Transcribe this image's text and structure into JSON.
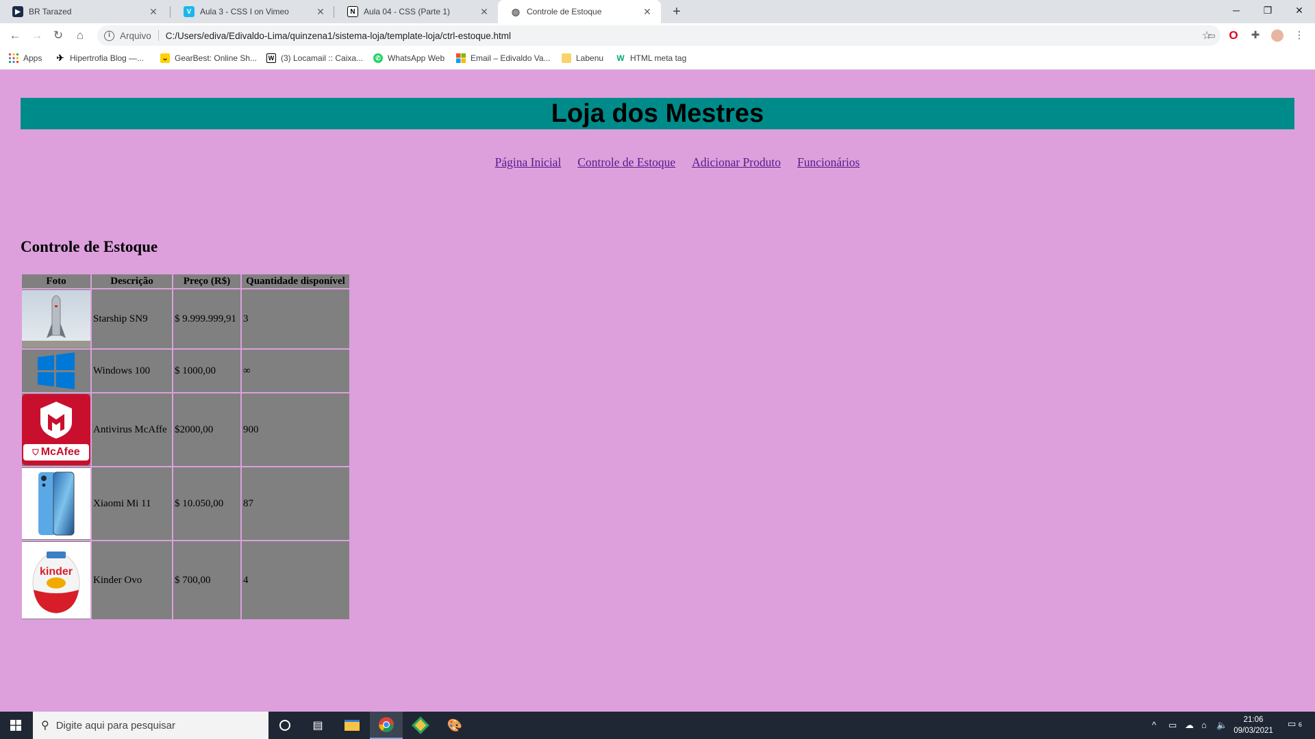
{
  "browser": {
    "tabs": [
      {
        "title": "BR Tarazed",
        "icon": "tarazed-favicon",
        "active": false
      },
      {
        "title": "Aula 3 - CSS I on Vimeo",
        "icon": "vimeo-favicon",
        "active": false
      },
      {
        "title": "Aula 04 - CSS (Parte 1)",
        "icon": "notion-favicon",
        "active": false
      },
      {
        "title": "Controle de Estoque",
        "icon": "globe-favicon",
        "active": true
      }
    ],
    "address": {
      "security_label": "Arquivo",
      "url": "C:/Users/ediva/Edivaldo-Lima/quinzena1/sistema-loja/template-loja/ctrl-estoque.html"
    },
    "bookmarks": [
      {
        "label": "Apps",
        "icon": "apps-grid-icon"
      },
      {
        "label": "Hipertrofia Blog —...",
        "icon": "hipertrofia-icon"
      },
      {
        "label": "GearBest: Online Sh...",
        "icon": "gearbest-icon"
      },
      {
        "label": "(3) Locamail :: Caixa...",
        "icon": "locamail-icon"
      },
      {
        "label": "WhatsApp Web",
        "icon": "whatsapp-icon"
      },
      {
        "label": "Email – Edivaldo Va...",
        "icon": "outlook-icon"
      },
      {
        "label": "Labenu",
        "icon": "folder-icon"
      },
      {
        "label": "HTML meta tag",
        "icon": "w3-icon"
      }
    ]
  },
  "page": {
    "title": "Loja dos Mestres",
    "nav": [
      {
        "label": "Página Inicial"
      },
      {
        "label": "Controle de Estoque"
      },
      {
        "label": "Adicionar Produto"
      },
      {
        "label": "Funcionários"
      }
    ],
    "section_title": "Controle de Estoque",
    "table": {
      "headers": [
        "Foto",
        "Descrição",
        "Preço (R$)",
        "Quantidade disponível"
      ],
      "rows": [
        {
          "photo": "starship-photo",
          "description": "Starship SN9",
          "price": "$ 9.999.999,91",
          "quantity": "3"
        },
        {
          "photo": "windows-logo",
          "description": "Windows 100",
          "price": "$ 1000,00",
          "quantity": "∞"
        },
        {
          "photo": "mcafee-logo",
          "description": "Antivirus McAffe",
          "price": "$2000,00",
          "quantity": "900",
          "logo_text": "McAfee"
        },
        {
          "photo": "xiaomi-phone-photo",
          "description": "Xiaomi Mi 11",
          "price": "$ 10.050,00",
          "quantity": "87"
        },
        {
          "photo": "kinder-ovo-photo",
          "description": "Kinder Ovo",
          "price": "$ 700,00",
          "quantity": "4",
          "logo_text": "kinder"
        }
      ]
    },
    "colors": {
      "background": "#dda0dd",
      "header": "#008b8b",
      "table_cell": "#808080",
      "link": "#551a8b"
    }
  },
  "taskbar": {
    "search_placeholder": "Digite aqui para pesquisar",
    "time": "21:06",
    "date": "09/03/2021",
    "notifications": "6"
  }
}
